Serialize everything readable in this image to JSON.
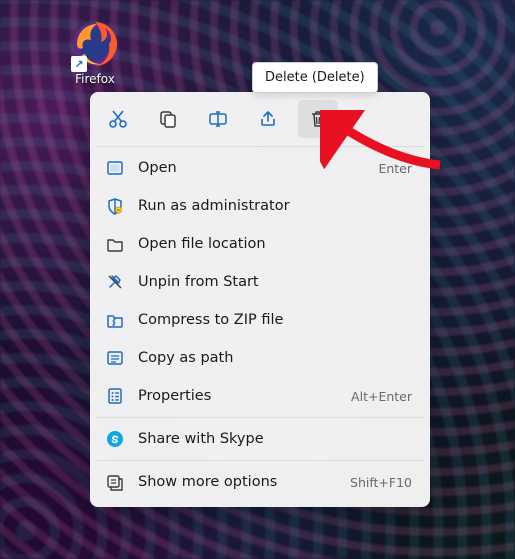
{
  "desktop": {
    "icon_label": "Firefox",
    "shortcut_arrow": "↗"
  },
  "tooltip": {
    "text": "Delete (Delete)"
  },
  "colors": {
    "accent_blue": "#1b6ec2",
    "icon_stroke": "#3a3a3a"
  },
  "action_row": [
    {
      "name": "cut-icon"
    },
    {
      "name": "copy-icon"
    },
    {
      "name": "rename-icon"
    },
    {
      "name": "share-icon"
    },
    {
      "name": "delete-icon",
      "hover": true
    }
  ],
  "menu": {
    "groups": [
      [
        {
          "icon": "open-icon",
          "label": "Open",
          "shortcut": "Enter"
        },
        {
          "icon": "shield-icon",
          "label": "Run as administrator",
          "shortcut": ""
        },
        {
          "icon": "folder-icon",
          "label": "Open file location",
          "shortcut": ""
        },
        {
          "icon": "unpin-icon",
          "label": "Unpin from Start",
          "shortcut": ""
        },
        {
          "icon": "zip-icon",
          "label": "Compress to ZIP file",
          "shortcut": ""
        },
        {
          "icon": "copypath-icon",
          "label": "Copy as path",
          "shortcut": ""
        },
        {
          "icon": "properties-icon",
          "label": "Properties",
          "shortcut": "Alt+Enter"
        }
      ],
      [
        {
          "icon": "skype-icon",
          "label": "Share with Skype",
          "shortcut": ""
        }
      ],
      [
        {
          "icon": "more-icon",
          "label": "Show more options",
          "shortcut": "Shift+F10"
        }
      ]
    ]
  }
}
